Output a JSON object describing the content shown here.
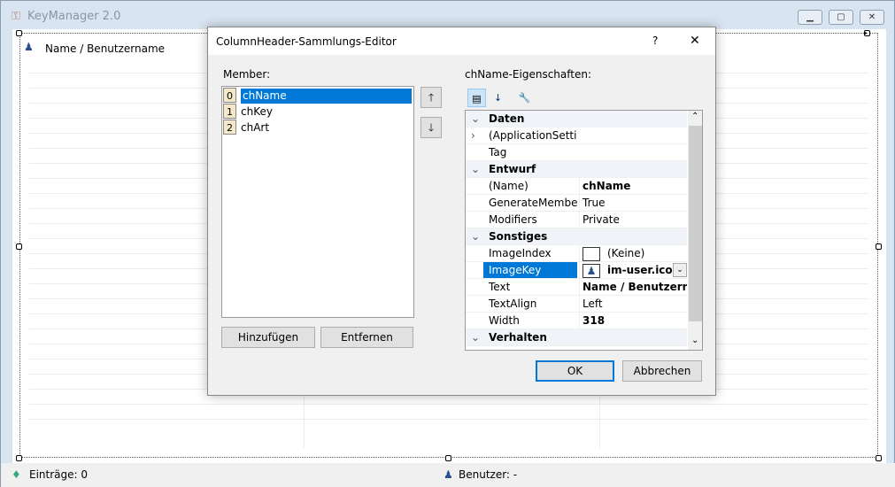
{
  "app": {
    "title": "KeyManager 2.0",
    "column_header": "Name / Benutzername",
    "status_entries": "Einträge: 0",
    "status_user": "Benutzer: -"
  },
  "dialog": {
    "title": "ColumnHeader-Sammlungs-Editor",
    "help": "?",
    "close": "✕",
    "members_label": "Member:",
    "members": [
      {
        "index": "0",
        "name": "chName"
      },
      {
        "index": "1",
        "name": "chKey"
      },
      {
        "index": "2",
        "name": "chArt"
      }
    ],
    "add_button": "Hinzufügen",
    "remove_button": "Entfernen",
    "props_label": "chName-Eigenschaften:",
    "ok": "OK",
    "cancel": "Abbrechen",
    "properties": [
      {
        "type": "cat",
        "key": "Daten"
      },
      {
        "type": "prop",
        "key": "(ApplicationSettings)",
        "value": "",
        "expandable": true
      },
      {
        "type": "prop",
        "key": "Tag",
        "value": ""
      },
      {
        "type": "cat",
        "key": "Entwurf"
      },
      {
        "type": "prop",
        "key": "(Name)",
        "value": "chName",
        "bold": true
      },
      {
        "type": "prop",
        "key": "GenerateMember",
        "value": "True"
      },
      {
        "type": "prop",
        "key": "Modifiers",
        "value": "Private"
      },
      {
        "type": "cat",
        "key": "Sonstiges"
      },
      {
        "type": "prop",
        "key": "ImageIndex",
        "value": "(Keine)",
        "swatch": "empty"
      },
      {
        "type": "prop",
        "key": "ImageKey",
        "value": "im-user.ico",
        "swatch": "user",
        "bold": true,
        "selected": true
      },
      {
        "type": "prop",
        "key": "Text",
        "value": "Name / Benutzername",
        "bold": true
      },
      {
        "type": "prop",
        "key": "TextAlign",
        "value": "Left"
      },
      {
        "type": "prop",
        "key": "Width",
        "value": "318",
        "bold": true
      },
      {
        "type": "cat",
        "key": "Verhalten"
      }
    ]
  },
  "colors": {
    "accent": "#0078d7"
  }
}
